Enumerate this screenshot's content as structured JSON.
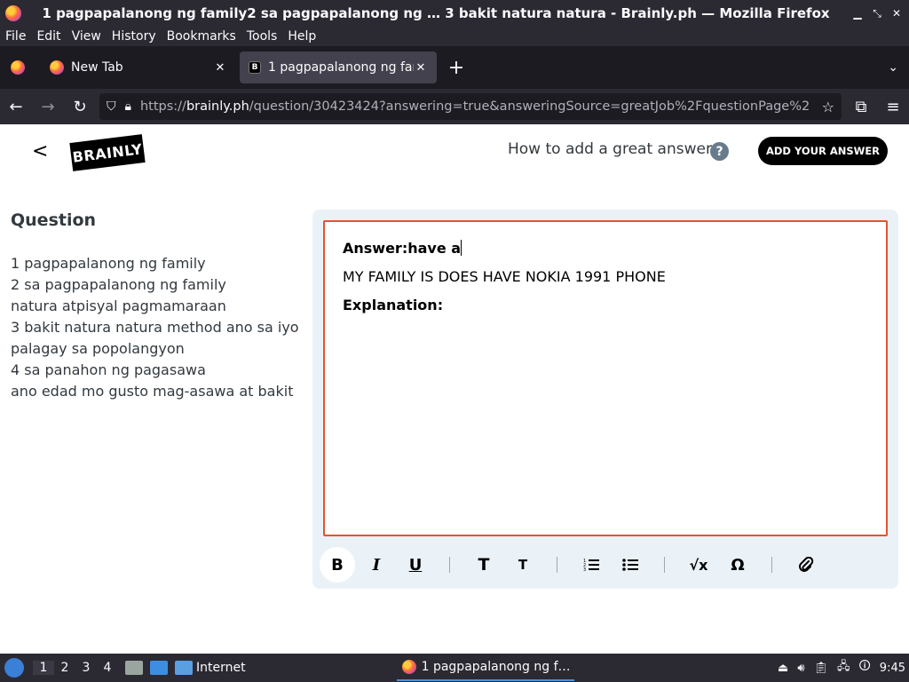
{
  "window": {
    "title": "1 pagpapalanong ng family2 sa pagpapalanong ng … 3 bakit natura natura - Brainly.ph — Mozilla Firefox"
  },
  "menu": [
    "File",
    "Edit",
    "View",
    "History",
    "Bookmarks",
    "Tools",
    "Help"
  ],
  "tabs": [
    {
      "label": "New Tab",
      "active": false
    },
    {
      "label": "1 pagpapalanong ng family2 sa pagpapalanong",
      "active": true
    }
  ],
  "url": {
    "prefix": "https://",
    "host": "brainly.ph",
    "path": "/question/30423424?answering=true&answeringSource=greatJob%2FquestionPage%2"
  },
  "header": {
    "logo_text": "BRAINLY",
    "how_to": "How to add a great answer",
    "help_icon": "?",
    "add_answer": "ADD YOUR ANSWER"
  },
  "question": {
    "title": "Question",
    "text": "1 pagpapalanong ng family\n2 sa pagpapalanong ng family\nnatura atpisyal pagmamaraan\n3 bakit natura natura method ano sa iyo\npalagay sa popolangyon\n4 sa panahon ng pagasawa\nano edad mo gusto mag-asawa at bakit"
  },
  "editor": {
    "line1": "Answer:have a",
    "line2": "MY FAMILY IS DOES HAVE NOKIA 1991 PHONE",
    "line3": "Explanation:"
  },
  "toolbar": {
    "bold": "B",
    "italic": "I",
    "underline": "U",
    "heading": "T",
    "subheading": "T",
    "math": "√x",
    "symbol": "Ω"
  },
  "taskbar": {
    "workspaces": [
      "1",
      "2",
      "3",
      "4"
    ],
    "internet_label": "Internet",
    "task_label": "1 pagpapalanong ng f…",
    "clock": "9:45"
  },
  "colors": {
    "editor_border": "#e8522e",
    "toolbar_bg": "#ebf2f7"
  }
}
